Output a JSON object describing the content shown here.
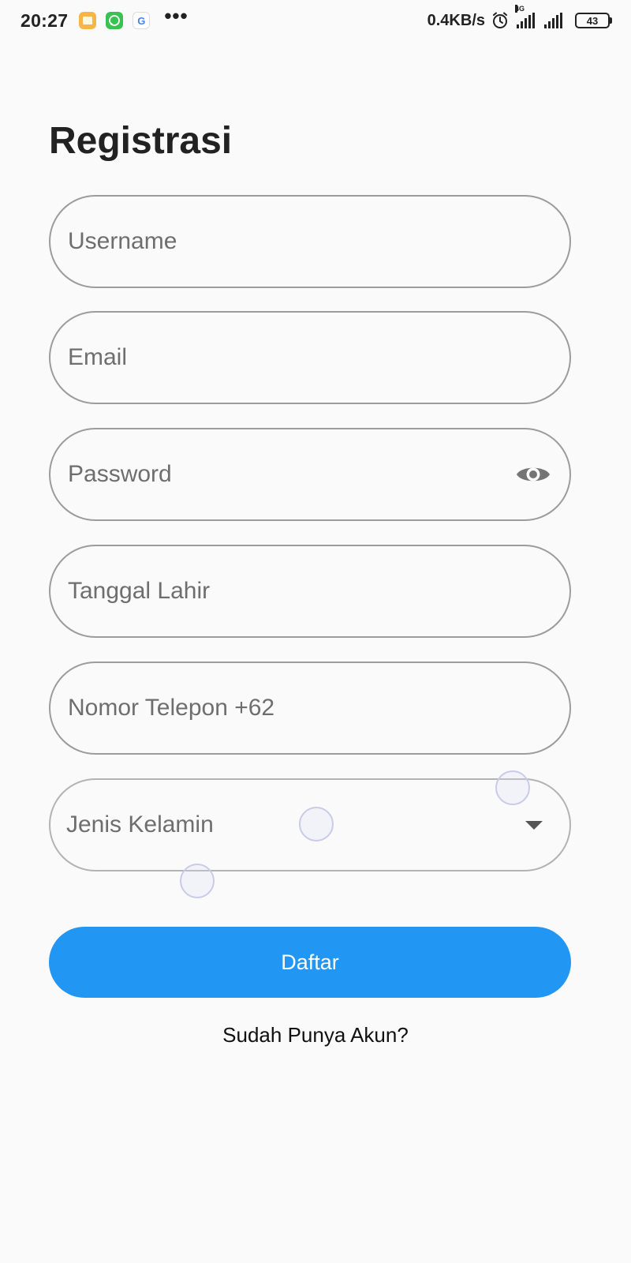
{
  "status_bar": {
    "time": "20:27",
    "more_indicator": "•••",
    "net_speed": "0.4KB/s",
    "net_type": "4G",
    "battery": "43",
    "google_letter": "G",
    "icons": [
      "notes-icon",
      "whatsapp-icon",
      "google-icon",
      "alarm-icon",
      "signal-icon",
      "battery-icon"
    ]
  },
  "page": {
    "title": "Registrasi"
  },
  "form": {
    "username_placeholder": "Username",
    "email_placeholder": "Email",
    "password_placeholder": "Password",
    "birthdate_placeholder": "Tanggal Lahir",
    "phone_placeholder": "Nomor Telepon +62",
    "gender_placeholder": "Jenis Kelamin",
    "submit_label": "Daftar",
    "login_link": "Sudah Punya Akun?"
  },
  "colors": {
    "primary": "#2196f3",
    "background": "#fafafa",
    "field_border": "#9c9c9c",
    "placeholder_text": "#6e6e6e"
  }
}
